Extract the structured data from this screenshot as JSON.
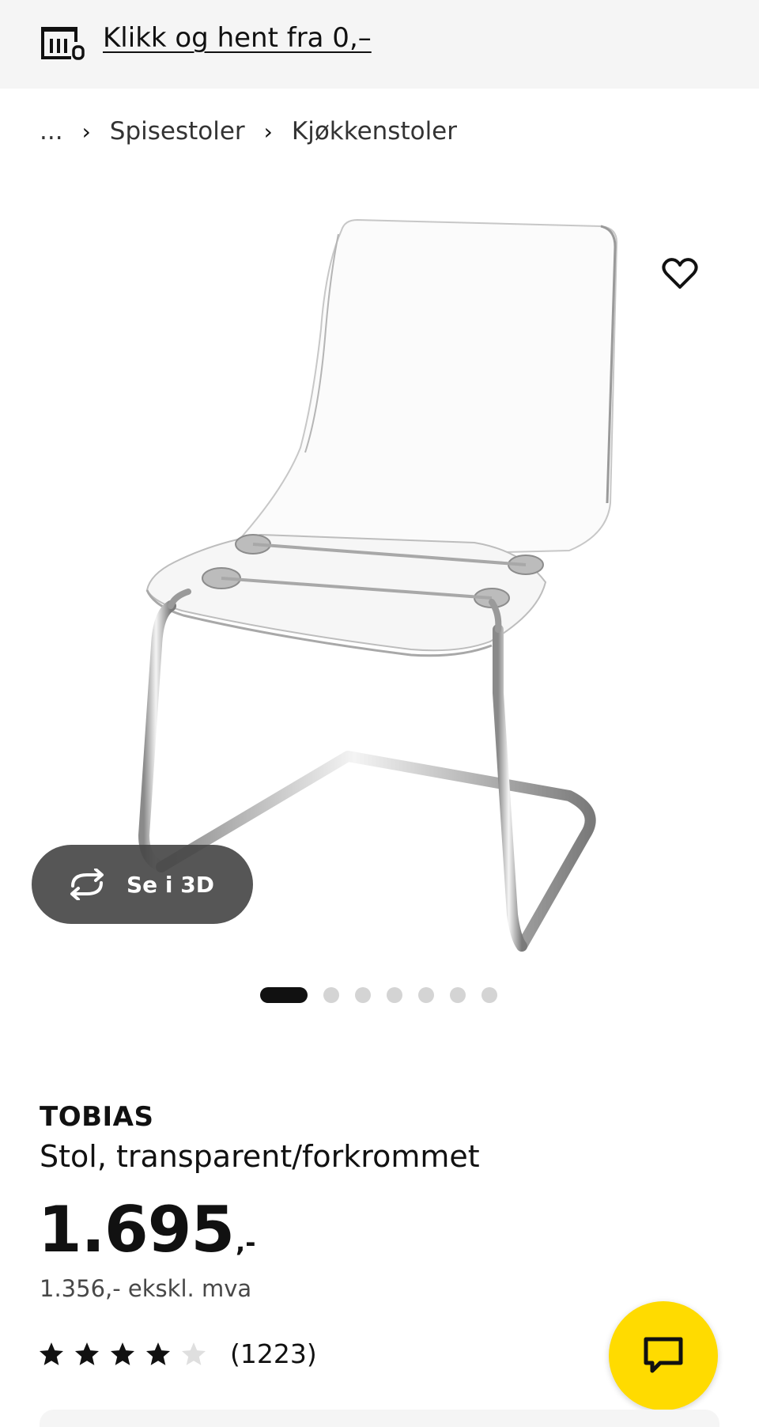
{
  "topbar": {
    "store_icon": "store-icon",
    "promo_text": "Klikk og hent fra 0,–"
  },
  "breadcrumb": {
    "ellipsis": "...",
    "items": [
      {
        "label": "Spisestoler"
      },
      {
        "label": "Kjøkkenstoler"
      }
    ]
  },
  "gallery": {
    "image_alt": "chair",
    "favorite_icon": "heart-icon",
    "view3d_label": "Se i 3D",
    "view3d_icon": "rotate-icon",
    "total_images": 7,
    "current_image": 1
  },
  "product": {
    "name": "TOBIAS",
    "description": "Stol, transparent/forkrommet",
    "price_main": "1.695",
    "price_suffix": ",-",
    "price_ex_vat": "1.356,- ekskl. mva",
    "rating": 4,
    "rating_max": 5,
    "review_count": "(1223)"
  },
  "colors": {
    "accent_yellow": "#ffdb00",
    "star_filled": "#111111",
    "star_empty": "#dfdfdf"
  },
  "chat": {
    "icon": "chat-icon"
  }
}
